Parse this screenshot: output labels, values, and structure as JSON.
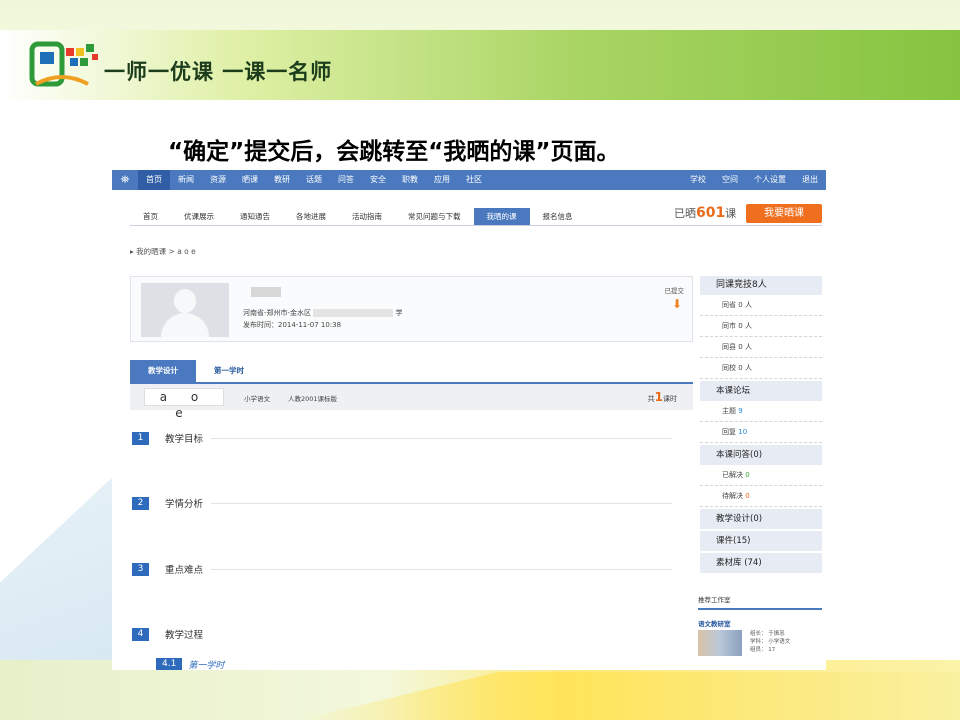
{
  "slide": {
    "logo_text": "一师一优课 一课一名师",
    "heading": "“确定”提交后，会跳转至“我晒的课”页面。"
  },
  "topnav": {
    "items": [
      "首页",
      "新闻",
      "资源",
      "晒课",
      "教研",
      "话题",
      "问答",
      "安全",
      "职教",
      "应用",
      "社区"
    ],
    "active": "首页",
    "right": [
      "学校",
      "空间",
      "个人设置",
      "退出"
    ]
  },
  "subnav": {
    "items": [
      "首页",
      "优课展示",
      "通知通告",
      "各地进展",
      "活动指南",
      "常见问题与下载",
      "我晒的课",
      "报名信息"
    ],
    "active": "我晒的课"
  },
  "count": {
    "prefix": "已晒",
    "value": "601",
    "suffix": "课"
  },
  "share_button": "我要晒课",
  "breadcrumb": "▸ 我的晒课 > a o e",
  "profile": {
    "location": "河南省-郑州市-金水区",
    "school_suffix": "学",
    "publish_time": "发布时间：2014-11-07 10:38",
    "status": "已提交"
  },
  "tabs": [
    "教学设计",
    "第一学时"
  ],
  "lesson": {
    "title": "a o e",
    "subject": "小学语文",
    "edition": "人教2001课标版",
    "periods_prefix": "共",
    "periods_value": "1",
    "periods_suffix": "课时"
  },
  "sections": [
    {
      "num": "1",
      "label": "教学目标"
    },
    {
      "num": "2",
      "label": "学情分析"
    },
    {
      "num": "3",
      "label": "重点难点"
    },
    {
      "num": "4",
      "label": "教学过程"
    }
  ],
  "subsection": {
    "num": "4.1",
    "label": "第一学时"
  },
  "sidebar": {
    "competition_title": "同课竞技8人",
    "competition_rows": [
      {
        "label": "同省",
        "value": "0",
        "unit": "人"
      },
      {
        "label": "同市",
        "value": "0",
        "unit": "人"
      },
      {
        "label": "同县",
        "value": "0",
        "unit": "人"
      },
      {
        "label": "同校",
        "value": "0",
        "unit": "人"
      }
    ],
    "forum_title": "本课论坛",
    "forum_rows": [
      {
        "label": "主题",
        "value": "9"
      },
      {
        "label": "回复",
        "value": "10"
      }
    ],
    "qa_title": "本课问答(0)",
    "qa_rows": [
      {
        "label": "已解决",
        "value": "0"
      },
      {
        "label": "待解决",
        "value": "0"
      }
    ],
    "links": [
      "教学设计(0)",
      "课件(15)",
      "素材库 (74)"
    ]
  },
  "studio": {
    "title": "推荐工作室",
    "name": "语文教研室",
    "leader": "组长：  于振忠",
    "subject": "学科：  小学语文",
    "members": "组员：  17"
  }
}
